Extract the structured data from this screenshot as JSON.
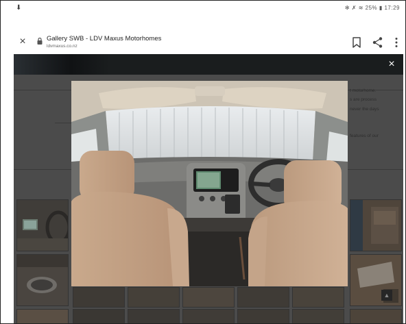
{
  "status_bar": {
    "download_glyph": "⬇",
    "right_text": "✻ ✗ ≋ 25% ▮ 17:29",
    "battery": "25%",
    "time": "17:29"
  },
  "browser": {
    "page_title": "Gallery SWB - LDV Maxus Motorhomes",
    "domain": "ldvmaxus.co.nz",
    "close_glyph": "×"
  },
  "lightbox": {
    "close_glyph": "×",
    "photo_alt": "Interior view from rear of van showing front seats, dashboard, steering wheel and windscreen"
  },
  "background_text": [
    "t motorhome.",
    "s are process",
    "never the days",
    "features of our"
  ],
  "scroll_top_glyph": "▲",
  "colors": {
    "overlay": "#4b4b4b",
    "lightbox_bar": "#1a1d1e",
    "toolbar": "#ffffff"
  },
  "icons": [
    "download-icon",
    "close-tab-icon",
    "lock-icon",
    "bookmark-icon",
    "share-icon",
    "more-vert-icon",
    "lightbox-close-icon",
    "scroll-top-icon"
  ]
}
